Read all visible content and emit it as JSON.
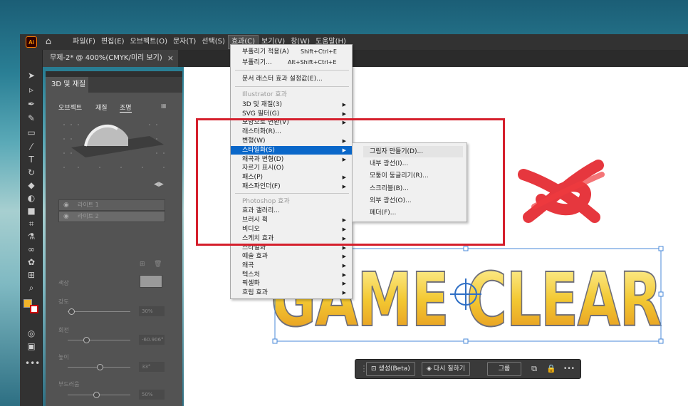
{
  "app": {
    "logo_text": "Ai",
    "home_icon": "home-icon"
  },
  "menubar": {
    "items": [
      "파일(F)",
      "편집(E)",
      "오브젝트(O)",
      "문자(T)",
      "선택(S)",
      "효과(C)",
      "보기(V)",
      "창(W)",
      "도움말(H)"
    ],
    "active_index": 5
  },
  "document_tab": {
    "title": "무제-2* @ 400%(CMYK/미리 보기)",
    "close": "×"
  },
  "panel": {
    "title": "3D 및 재질",
    "tabs": [
      "오브젝트",
      "재질",
      "조명"
    ],
    "selected_tab": 2,
    "lights": [
      "라이트 1",
      "라이트 2"
    ],
    "labels": {
      "color": "색상",
      "intensity": "강도",
      "rotation": "회전",
      "height": "높이",
      "softness": "부드러움"
    },
    "values": {
      "intensity": "30%",
      "rotation": "-60.906°",
      "height": "33°",
      "softness": "50%"
    }
  },
  "effect_menu": {
    "items": [
      {
        "label": "부풀리기 적용(A)",
        "shortcut": "Shift+Ctrl+E"
      },
      {
        "label": "부풀리기...",
        "shortcut": "Alt+Shift+Ctrl+E"
      },
      {
        "label": "문서 래스터 효과 설정값(E)..."
      },
      {
        "label": "Illustrator 효과",
        "disabled": true
      },
      {
        "label": "3D 및 재질(3)",
        "submenu": true
      },
      {
        "label": "SVG 필터(G)",
        "submenu": true
      },
      {
        "label": "모양으로 변환(V)",
        "submenu": true
      },
      {
        "label": "래스터화(R)..."
      },
      {
        "label": "변형(W)",
        "submenu": true
      },
      {
        "label": "스타일화(S)",
        "submenu": true,
        "selected": true
      },
      {
        "label": "왜곡과 변형(D)",
        "submenu": true
      },
      {
        "label": "자르기 표시(O)"
      },
      {
        "label": "패스(P)",
        "submenu": true
      },
      {
        "label": "패스파인더(F)",
        "submenu": true
      },
      {
        "label": "Photoshop 효과",
        "disabled": true
      },
      {
        "label": "효과 갤러리..."
      },
      {
        "label": "브러시 획",
        "submenu": true
      },
      {
        "label": "비디오",
        "submenu": true
      },
      {
        "label": "스케치 효과",
        "submenu": true
      },
      {
        "label": "스타일화",
        "submenu": true
      },
      {
        "label": "예술 효과",
        "submenu": true
      },
      {
        "label": "왜곡",
        "submenu": true
      },
      {
        "label": "텍스처",
        "submenu": true
      },
      {
        "label": "픽셀화",
        "submenu": true
      },
      {
        "label": "흐림 효과",
        "submenu": true
      }
    ]
  },
  "stylize_submenu": [
    "그림자 만들기(D)...",
    "내부 광선(I)...",
    "모퉁이 둥글리기(R)...",
    "스크리블(B)...",
    "외부 광선(O)...",
    "페더(F)..."
  ],
  "artwork": {
    "text": "GAME CLEAR"
  },
  "context_bar": {
    "generate": "생성(Beta)",
    "recolor": "다시 칠하기",
    "group": "그룹",
    "more": "•••"
  },
  "colors": {
    "accent": "#0a67c9",
    "highlight_box": "#d51f2c",
    "art_fill": "#f3c832",
    "art_stroke": "#6e6e78"
  }
}
